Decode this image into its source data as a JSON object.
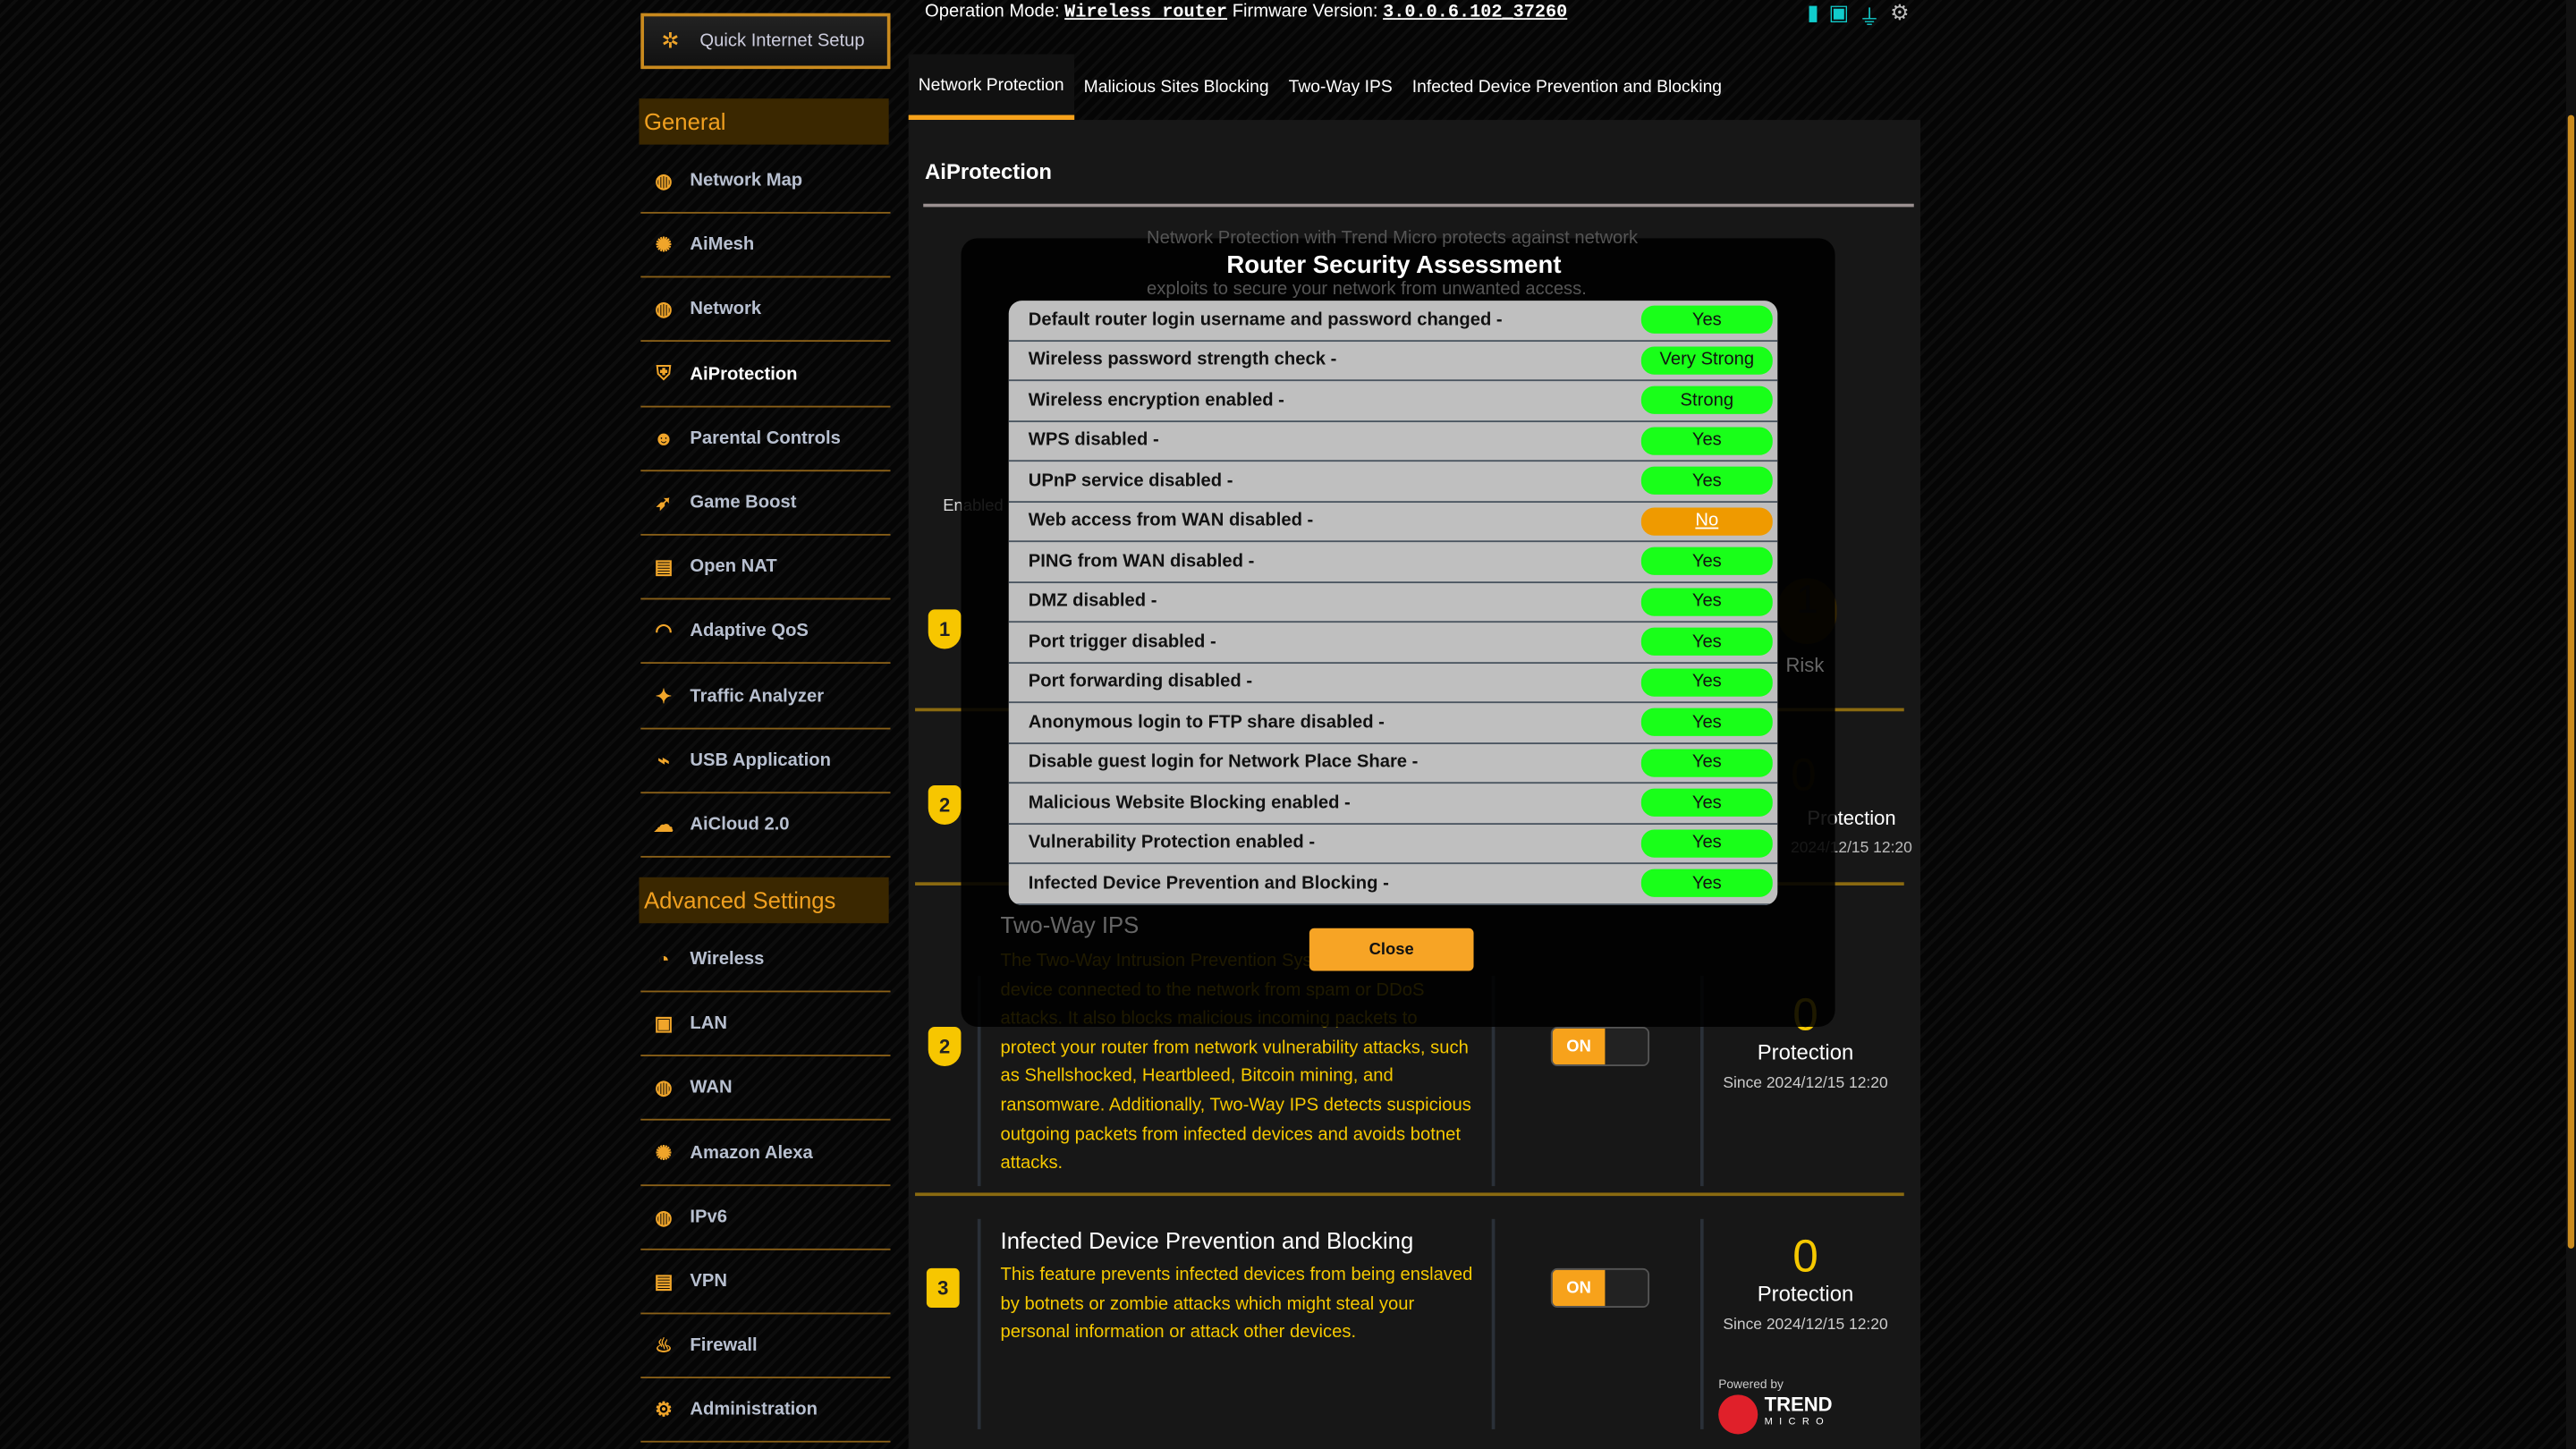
{
  "header": {
    "operation_mode_label": "Operation Mode:",
    "operation_mode": "Wireless router",
    "firmware_label": "Firmware Version:",
    "firmware": "3.0.0.6.102_37260"
  },
  "sidebar": {
    "quick_setup": "Quick Internet Setup",
    "general": "General",
    "general_items": [
      {
        "label": "Network Map",
        "icon": "globe-pin-icon"
      },
      {
        "label": "AiMesh",
        "icon": "mesh-icon"
      },
      {
        "label": "Network",
        "icon": "network-users-icon"
      },
      {
        "label": "AiProtection",
        "icon": "shield-lock-icon"
      },
      {
        "label": "Parental Controls",
        "icon": "family-icon"
      },
      {
        "label": "Game Boost",
        "icon": "rocket-icon"
      },
      {
        "label": "Open NAT",
        "icon": "nat-icon"
      },
      {
        "label": "Adaptive QoS",
        "icon": "gauge-icon"
      },
      {
        "label": "Traffic Analyzer",
        "icon": "analyzer-icon"
      },
      {
        "label": "USB Application",
        "icon": "usb-icon"
      },
      {
        "label": "AiCloud 2.0",
        "icon": "cloud-icon"
      }
    ],
    "advanced": "Advanced Settings",
    "advanced_items": [
      {
        "label": "Wireless",
        "icon": "wifi-icon"
      },
      {
        "label": "LAN",
        "icon": "lan-icon"
      },
      {
        "label": "WAN",
        "icon": "globe-icon"
      },
      {
        "label": "Amazon Alexa",
        "icon": "alexa-icon"
      },
      {
        "label": "IPv6",
        "icon": "ipv6-icon"
      },
      {
        "label": "VPN",
        "icon": "vpn-icon"
      },
      {
        "label": "Firewall",
        "icon": "firewall-icon"
      },
      {
        "label": "Administration",
        "icon": "admin-icon"
      }
    ]
  },
  "tabs": [
    "Network Protection",
    "Malicious Sites Blocking",
    "Two-Way IPS",
    "Infected Device Prevention and Blocking"
  ],
  "panel": {
    "title": "AiProtection",
    "intro1": "Network Protection with Trend Micro protects against network",
    "intro2": "exploits to secure your network from unwanted access.",
    "enabled": "Enabled",
    "risk_count": "1",
    "risk_label": "Risk",
    "mal": {
      "badge": "2",
      "count": "0",
      "label": "Protection",
      "since": "2024/12/15 12:20"
    },
    "ips": {
      "badge": "2",
      "title": "Two-Way IPS",
      "desc": "The Two-Way Intrusion Prevention System protects any device connected to the network from spam or DDoS attacks. It also blocks malicious incoming packets to protect your router from network vulnerability attacks, such as Shellshocked, Heartbleed, Bitcoin mining, and ransomware. Additionally, Two-Way IPS detects suspicious outgoing packets from infected devices and avoids botnet attacks.",
      "toggle": "ON",
      "count": "0",
      "label": "Protection",
      "since": "Since 2024/12/15 12:20"
    },
    "idp": {
      "badge": "3",
      "title": "Infected Device Prevention and Blocking",
      "desc": "This feature prevents infected devices from being enslaved by botnets or zombie attacks which might steal your personal information or attack other devices.",
      "toggle": "ON",
      "count": "0",
      "label": "Protection",
      "since": "Since 2024/12/15 12:20"
    },
    "np_badge": "1",
    "powered_by": "Powered by",
    "trend": "TREND",
    "micro": "MICRO"
  },
  "modal": {
    "title": "Router Security Assessment",
    "close": "Close",
    "rows": [
      {
        "label": "Default router login username and password changed -",
        "value": "Yes",
        "status": "ok"
      },
      {
        "label": "Wireless password strength check -",
        "value": "Very Strong",
        "status": "ok"
      },
      {
        "label": "Wireless encryption enabled -",
        "value": "Strong",
        "status": "ok"
      },
      {
        "label": "WPS disabled -",
        "value": "Yes",
        "status": "ok"
      },
      {
        "label": "UPnP service disabled -",
        "value": "Yes",
        "status": "ok"
      },
      {
        "label": "Web access from WAN disabled -",
        "value": "No",
        "status": "warn"
      },
      {
        "label": "PING from WAN disabled -",
        "value": "Yes",
        "status": "ok"
      },
      {
        "label": "DMZ disabled -",
        "value": "Yes",
        "status": "ok"
      },
      {
        "label": "Port trigger disabled -",
        "value": "Yes",
        "status": "ok"
      },
      {
        "label": "Port forwarding disabled -",
        "value": "Yes",
        "status": "ok"
      },
      {
        "label": "Anonymous login to FTP share disabled -",
        "value": "Yes",
        "status": "ok"
      },
      {
        "label": "Disable guest login for Network Place Share -",
        "value": "Yes",
        "status": "ok"
      },
      {
        "label": "Malicious Website Blocking enabled -",
        "value": "Yes",
        "status": "ok"
      },
      {
        "label": "Vulnerability Protection enabled -",
        "value": "Yes",
        "status": "ok"
      },
      {
        "label": "Infected Device Prevention and Blocking -",
        "value": "Yes",
        "status": "ok"
      }
    ]
  },
  "colors": {
    "accent": "#f7a21b",
    "ok": "#19ff19",
    "warn": "#ef9a00",
    "highlight": "#f5c800"
  }
}
